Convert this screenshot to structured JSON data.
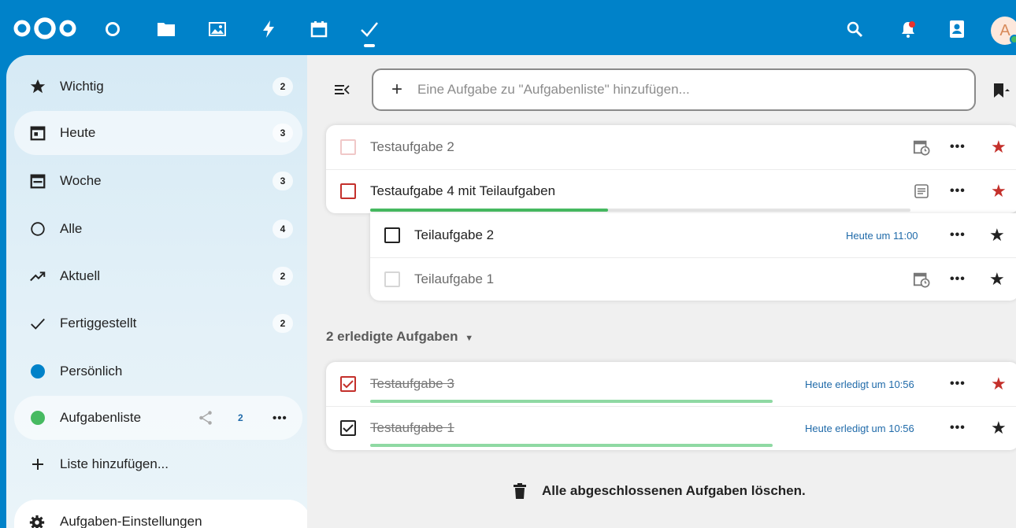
{
  "header": {
    "apps": [
      "dashboard-icon",
      "files-icon",
      "photos-icon",
      "activity-icon",
      "calendar-icon",
      "tasks-icon"
    ],
    "avatar_letter": "A"
  },
  "sidebar": {
    "items": [
      {
        "label": "Wichtig",
        "count": "2"
      },
      {
        "label": "Heute",
        "count": "3"
      },
      {
        "label": "Woche",
        "count": "3"
      },
      {
        "label": "Alle",
        "count": "4"
      },
      {
        "label": "Aktuell",
        "count": "2"
      },
      {
        "label": "Fertiggestellt",
        "count": "2"
      }
    ],
    "lists": [
      {
        "label": "Persönlich",
        "color": "#0082c9"
      },
      {
        "label": "Aufgabenliste",
        "color": "#46ba61",
        "count": "2"
      }
    ],
    "add_list": "Liste hinzufügen...",
    "settings": "Aufgaben-Einstellungen"
  },
  "main": {
    "add_placeholder": "Eine Aufgabe zu \"Aufgabenliste\" hinzufügen...",
    "open_tasks": [
      {
        "title": "Testaufgabe 2"
      },
      {
        "title": "Testaufgabe 4 mit Teilaufgaben",
        "progress": 0.44
      }
    ],
    "subtasks": [
      {
        "title": "Teilaufgabe 2",
        "due": "Heute um 11:00"
      },
      {
        "title": "Teilaufgabe 1"
      }
    ],
    "completed_header": "2 erledigte Aufgaben",
    "completed_tasks": [
      {
        "title": "Testaufgabe 3",
        "due": "Heute erledigt um 10:56",
        "progress": 0.7
      },
      {
        "title": "Testaufgabe 1",
        "due": "Heute erledigt um 10:56",
        "progress": 0.7
      }
    ],
    "delete_completed": "Alle abgeschlossenen Aufgaben löschen.",
    "more_label": "•••",
    "colors": {
      "accent": "#0082c9",
      "priority": "#c4302b",
      "progress": "#46ba61"
    }
  }
}
